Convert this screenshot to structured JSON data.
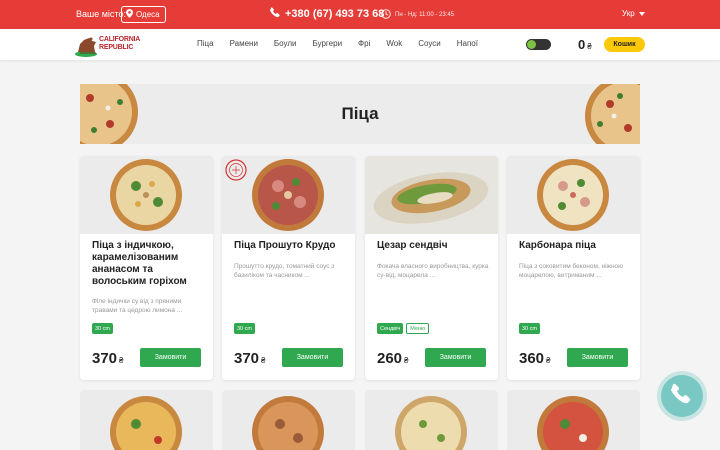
{
  "topbar": {
    "city_label": "Ваше місто:",
    "city": "Одеса",
    "phone": "+380 (67) 493 73 68",
    "hours": "Пн - Нд: 11:00 - 23:45",
    "language": "Укр"
  },
  "header": {
    "logo_line1": "CALIFORNIA",
    "logo_line2": "REPUBLIC",
    "nav": [
      "Піца",
      "Рамени",
      "Боули",
      "Бургери",
      "Фрі",
      "Wok",
      "Соуси",
      "Напої"
    ],
    "cart_total": "0",
    "currency": "₴",
    "cart_button": "Кошик"
  },
  "banner": {
    "title": "Піца"
  },
  "products": [
    {
      "name": "Піца з індичкою, карамелізованим ананасом та волоським горіхом",
      "description": "Філе індички су від з пряними травами та цедрою лимона ...",
      "tags": [
        "30 cm"
      ],
      "price": "370",
      "button": "Замовити"
    },
    {
      "name": "Піца Прошуто Крудо",
      "description": "Прошутто крудо, томатний соус з базиліком та часником ...",
      "tags": [
        "30 cm"
      ],
      "price": "370",
      "button": "Замовити",
      "badge": "CHEF'S CHOICE"
    },
    {
      "name": "Цезар сендвіч",
      "description": "Фокача власного виробництва, курка су-від, моцарела ...",
      "tags": [
        "Сендвіч",
        "Меню"
      ],
      "price": "260",
      "button": "Замовити"
    },
    {
      "name": "Карбонара піца",
      "description": "Піца з соковитим беконом, ніжною моцарелою, витриманим ...",
      "tags": [
        "30 cm"
      ],
      "price": "360",
      "button": "Замовити"
    }
  ],
  "colors": {
    "topbar": "#e63c38",
    "accent_green": "#2fa84f",
    "cart_yellow": "#fcc80a",
    "call_button": "#79c8c4"
  }
}
